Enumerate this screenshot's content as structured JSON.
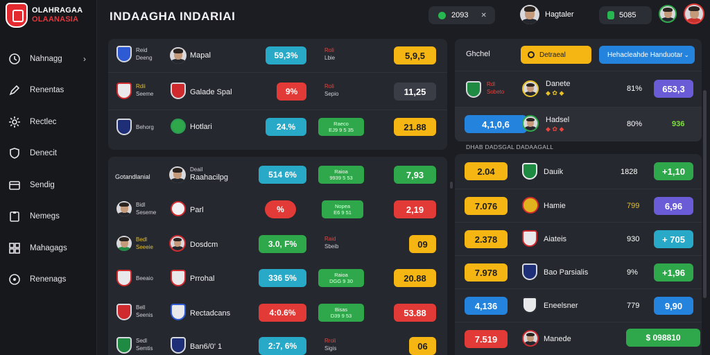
{
  "brand": {
    "line1": "OLAHRAGAA",
    "line2": "OLAANASIA"
  },
  "sidebar": {
    "items": [
      {
        "label": "Nahnagg",
        "icon": "clock-icon",
        "chevron": "›"
      },
      {
        "label": "Renentas",
        "icon": "pen-icon"
      },
      {
        "label": "Rectlec",
        "icon": "gear-icon"
      },
      {
        "label": "Denecit",
        "icon": "shield-icon"
      },
      {
        "label": "Sendig",
        "icon": "card-icon"
      },
      {
        "label": "Nemegs",
        "icon": "clipboard-icon"
      },
      {
        "label": "Mahagags",
        "icon": "grid-icon"
      },
      {
        "label": "Renenags",
        "icon": "location-icon"
      }
    ]
  },
  "header": {
    "title": "INDAAGHA INDARIAI",
    "balance": "2093",
    "balance_chevron": "✕",
    "user_name": "Hagtaler",
    "coins": "5085"
  },
  "panel_top": {
    "rows": [
      {
        "info1": "Reid",
        "info2": "Deeng",
        "team": "Mapal",
        "pct": "59,3%",
        "mid1": "Roli",
        "mid2": "Lbie",
        "odds": "5,9,5"
      },
      {
        "info1": "Rdii",
        "info2": "Seeme",
        "team": "Galade Spal",
        "pct": "9%",
        "mid1": "Roli",
        "mid2": "Sepio",
        "odds": "11,25"
      },
      {
        "info1": "Behorg",
        "info2": "",
        "team": "Hotlari",
        "pct": "24.%",
        "mid1": "Raeco",
        "mid2": "EJ9 9 5 35",
        "odds": "21.88"
      }
    ]
  },
  "panel_main": {
    "rows": [
      {
        "info1": "Gotandlanial",
        "info2": "",
        "team_sub": "Deail",
        "team": "Raahacilpg",
        "pct": "514 6%",
        "mid1": "Raioa",
        "mid2": "9939 5 53",
        "odds": "7,93"
      },
      {
        "info1": "Bidl",
        "info2": "Seseme",
        "team": "Parl",
        "pct": "%",
        "mid1": "Nopea",
        "mid2": "E6 9 51",
        "odds": "2,19"
      },
      {
        "info1": "Bedl",
        "info2": "Seeeie",
        "team": "Dosdcm",
        "pct": "3.0, F%",
        "mid1": "Raid",
        "mid2": "Sbeib",
        "odds": "09"
      },
      {
        "info1": "Beeaio",
        "info2": "",
        "team": "Prrohal",
        "pct": "336 5%",
        "mid1": "Raioa",
        "mid2": "DGG 9 30",
        "odds": "20.88"
      },
      {
        "info1": "Bell",
        "info2": "Seenis",
        "team": "Rectadcans",
        "pct": "4:0.6%",
        "mid1": "Bisas",
        "mid2": "D39 9 53",
        "odds": "53.88"
      },
      {
        "info1": "Sedl",
        "info2": "Semtis",
        "team": "Ban6/0' 1",
        "pct": "2:7, 6%",
        "mid1": "Rroli",
        "mid2": "Sigis",
        "odds": "06"
      }
    ]
  },
  "right_top": {
    "label": "Ghchel",
    "tab_yellow": "Detraeal",
    "tab_blue": "Hehacleahde Handuotar",
    "rows": [
      {
        "info1": "Rdl",
        "info2": "Sobeto",
        "team": "Danete",
        "pct": "81%",
        "odds": "653,3"
      },
      {
        "score": "4,1,0,6",
        "team": "Hadsel",
        "pct": "80%",
        "odds": "936"
      }
    ]
  },
  "right_caption": "DHAB DADSGAL DADAAGALL",
  "right_list": {
    "rows": [
      {
        "score": "2.04",
        "team": "Dauik",
        "num": "1828",
        "odds": "+1,10"
      },
      {
        "score": "7.076",
        "team": "Hamie",
        "num": "799",
        "odds": "6,96"
      },
      {
        "score": "2.378",
        "team": "Aiateis",
        "num": "930",
        "odds": "+ 705"
      },
      {
        "score": "7.978",
        "team": "Bao Parsialis",
        "num": "9%",
        "odds": "+1,96"
      },
      {
        "score": "4,136",
        "team": "Eneelsner",
        "num": "779",
        "odds": "9,90"
      },
      {
        "score": "7.519",
        "team": "Manede",
        "num": "",
        "odds": "$ 098810"
      }
    ]
  },
  "colors": {
    "accent_green": "#2ea84a",
    "accent_yellow": "#f5b614",
    "accent_red": "#e23a36",
    "accent_cyan": "#27a9c7",
    "accent_blue": "#2483dd"
  }
}
